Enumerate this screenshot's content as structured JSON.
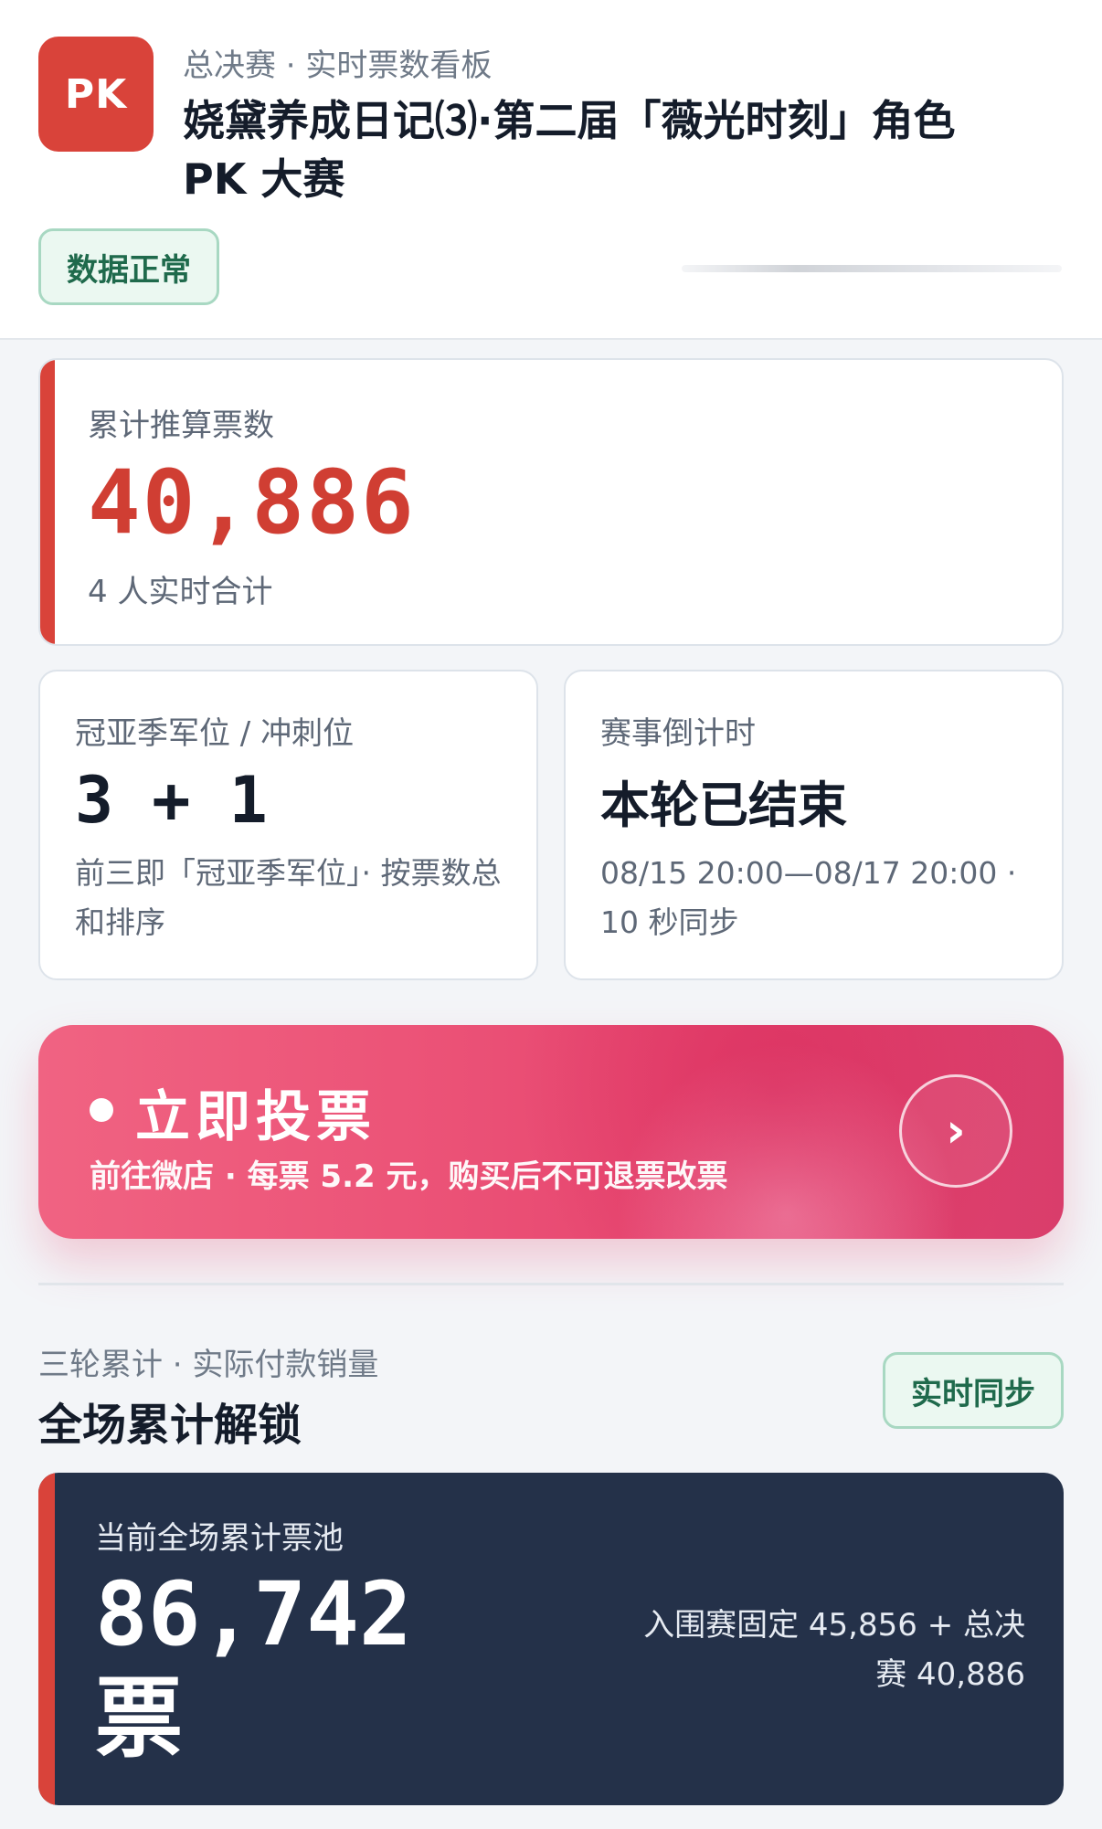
{
  "header": {
    "logo_text": "PK",
    "subtitle": "总决赛 · 实时票数看板",
    "title": "娆黛养成日记⑶·第二届「薇光时刻」角色 PK 大赛",
    "status": "数据正常"
  },
  "votes_card": {
    "label": "累计推算票数",
    "value": "40,886",
    "note": "4 人实时合计"
  },
  "rank_card": {
    "label": "冠亚季军位 / 冲刺位",
    "value": "3 + 1",
    "note": "前三即「冠亚季军位」· 按票数总和排序"
  },
  "countdown_card": {
    "label": "赛事倒计时",
    "value": "本轮已结束",
    "note": "08/15 20:00—08/17 20:00 · 10 秒同步"
  },
  "vote_button": {
    "title": "立即投票",
    "subtitle": "前往微店 · 每票 5.2 元，购买后不可退票改票",
    "arrow": "›"
  },
  "cumulative": {
    "subtitle": "三轮累计 · 实际付款销量",
    "title": "全场累计解锁",
    "sync_label": "实时同步"
  },
  "pool": {
    "label": "当前全场累计票池",
    "value": "86,742 票",
    "detail": "入围赛固定 45,856 + 总决赛 40,886"
  },
  "colors": {
    "accent_red": "#d9433a",
    "green_pill_border": "#a8d8c2",
    "vote_pink": "#ec5478",
    "pool_navy": "#243149"
  },
  "icons": {
    "vote_arrow": "chevron-right-icon"
  }
}
